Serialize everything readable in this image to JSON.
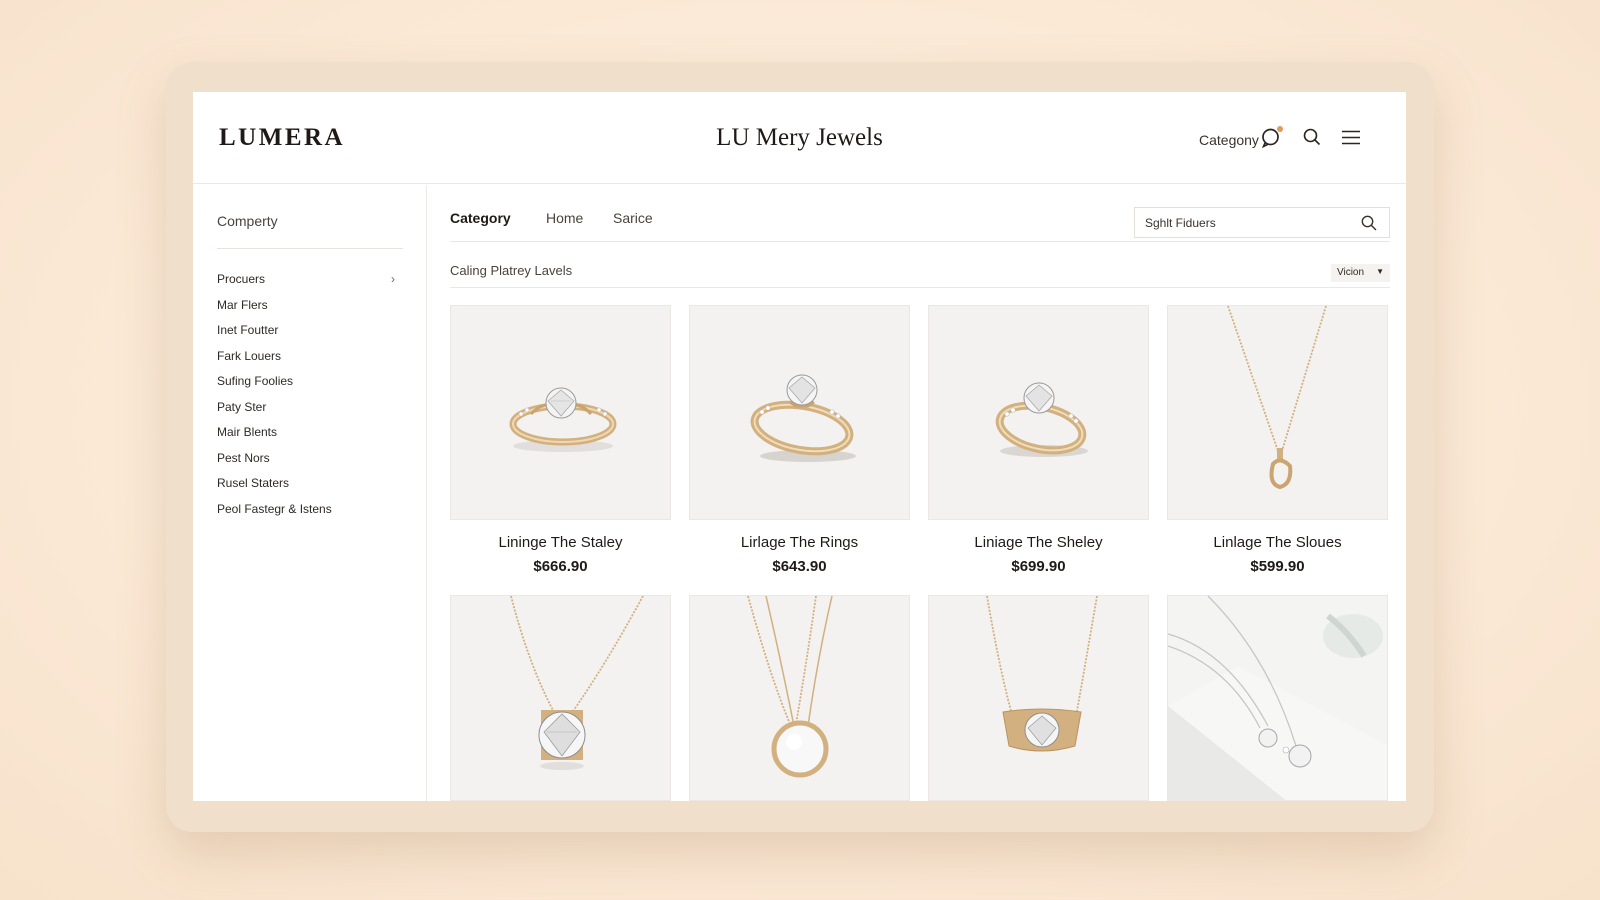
{
  "brand": {
    "logo": "LUMERA",
    "site_title": "LU Mery Jewels"
  },
  "header": {
    "category_label": "Categony",
    "icons": [
      "chat-icon",
      "search-icon",
      "menu-icon"
    ]
  },
  "sidebar": {
    "title": "Comperty",
    "items": [
      {
        "label": "Procuers",
        "has_chevron": true
      },
      {
        "label": "Mar Flers"
      },
      {
        "label": "Inet Foutter"
      },
      {
        "label": "Fark Louers"
      },
      {
        "label": "Sufing Foolies"
      },
      {
        "label": "Paty Ster"
      },
      {
        "label": "Mair Blents"
      },
      {
        "label": "Pest Nors"
      },
      {
        "label": "Rusel Staters"
      },
      {
        "label": "Peol Fastegr & Istens"
      }
    ]
  },
  "main": {
    "tabs": [
      {
        "label": "Category",
        "active": true
      },
      {
        "label": "Home",
        "active": false
      },
      {
        "label": "Sarice",
        "active": false
      }
    ],
    "search": {
      "value": "Sghlt Fiduers"
    },
    "subheading": "Caling Platrey Lavels",
    "view_select": "Vicion"
  },
  "products": [
    {
      "name": "Lininge The Staley",
      "price": "$666.90",
      "image": "ring"
    },
    {
      "name": "Lirlage The Rings",
      "price": "$643.90",
      "image": "ring"
    },
    {
      "name": "Liniage The Sheley",
      "price": "$699.90",
      "image": "ring"
    },
    {
      "name": "Linlage The Sloues",
      "price": "$599.90",
      "image": "pendant-necklace"
    },
    {
      "name": "",
      "price": "",
      "image": "diamond-pendant-necklace"
    },
    {
      "name": "",
      "price": "",
      "image": "pearl-pendant-necklace"
    },
    {
      "name": "",
      "price": "",
      "image": "gold-bar-diamond-necklace"
    },
    {
      "name": "",
      "price": "",
      "image": "double-diamond-necklace"
    }
  ],
  "colors": {
    "background": "#fbe9d6",
    "gold": "#d2b07f",
    "accent_dot": "#e09a5a",
    "text": "#1f1a17"
  }
}
